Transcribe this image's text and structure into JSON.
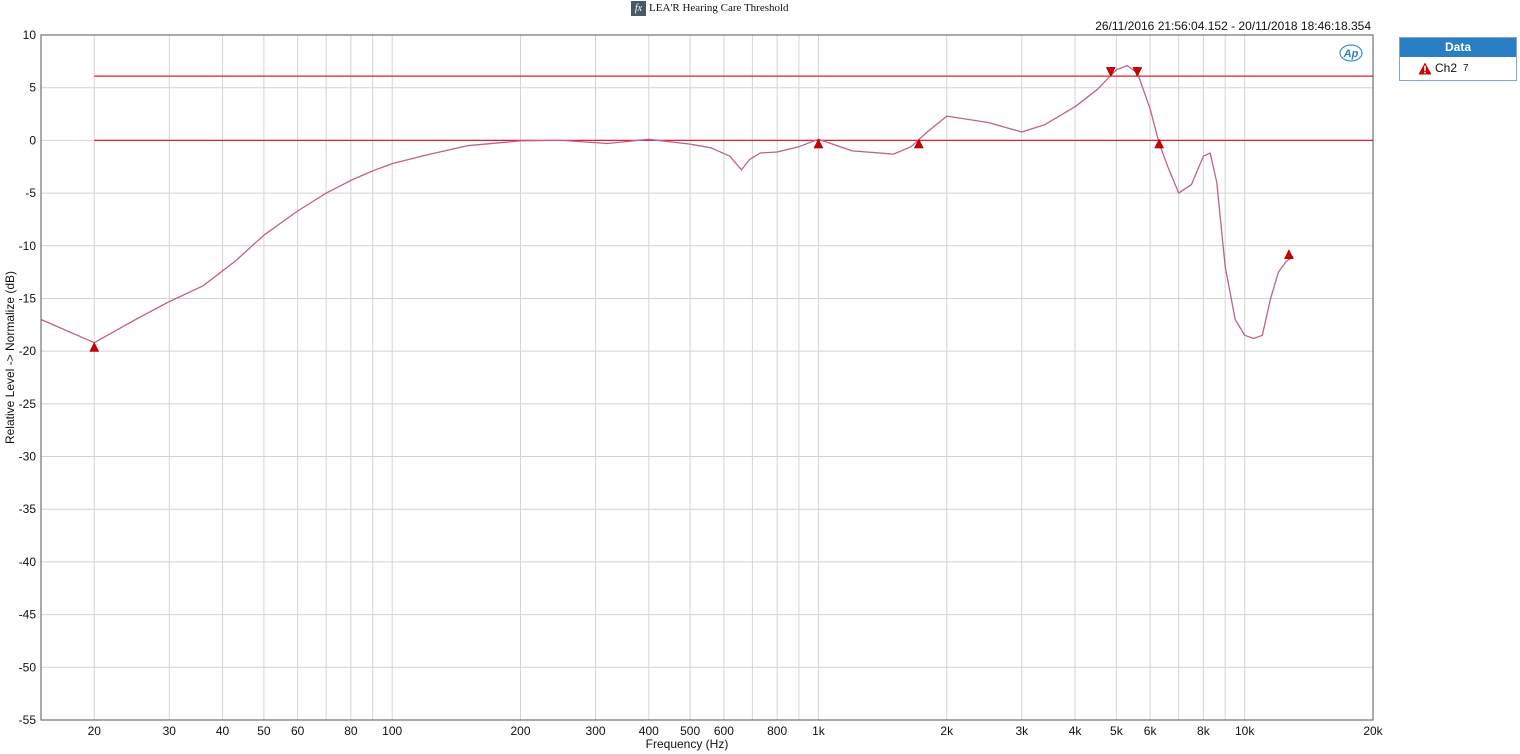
{
  "header": {
    "title": "LEA'R Hearing Care Threshold",
    "icon": "fx-icon",
    "timestamp": "26/11/2016 21:56:04.152 - 20/11/2018 18:46:18.354",
    "logo": "Ap"
  },
  "legend": {
    "header": "Data",
    "items": [
      {
        "label": "Ch2",
        "sub": "7",
        "color": "#cc0000"
      }
    ]
  },
  "chart_data": {
    "type": "line",
    "xlabel": "Frequency (Hz)",
    "ylabel": "Relative Level -> Normalize (dB)",
    "xscale": "log",
    "xlim": [
      15,
      20000
    ],
    "ylim": [
      -55,
      10
    ],
    "grid": true,
    "legend_position": "right",
    "x_ticks": [
      {
        "v": 20,
        "label": "20"
      },
      {
        "v": 30,
        "label": "30"
      },
      {
        "v": 40,
        "label": "40"
      },
      {
        "v": 50,
        "label": "50"
      },
      {
        "v": 60,
        "label": "60"
      },
      {
        "v": 80,
        "label": "80"
      },
      {
        "v": 100,
        "label": "100"
      },
      {
        "v": 200,
        "label": "200"
      },
      {
        "v": 300,
        "label": "300"
      },
      {
        "v": 400,
        "label": "400"
      },
      {
        "v": 500,
        "label": "500"
      },
      {
        "v": 600,
        "label": "600"
      },
      {
        "v": 800,
        "label": "800"
      },
      {
        "v": 1000,
        "label": "1k"
      },
      {
        "v": 2000,
        "label": "2k"
      },
      {
        "v": 3000,
        "label": "3k"
      },
      {
        "v": 4000,
        "label": "4k"
      },
      {
        "v": 5000,
        "label": "5k"
      },
      {
        "v": 6000,
        "label": "6k"
      },
      {
        "v": 8000,
        "label": "8k"
      },
      {
        "v": 10000,
        "label": "10k"
      },
      {
        "v": 20000,
        "label": "20k"
      }
    ],
    "y_ticks": [
      10,
      5,
      0,
      -5,
      -10,
      -15,
      -20,
      -25,
      -30,
      -35,
      -40,
      -45,
      -50,
      -55
    ],
    "reference_lines": [
      {
        "y": 6.1,
        "color": "#dd2222"
      },
      {
        "y": 0,
        "color": "#dd2222"
      }
    ],
    "series": [
      {
        "name": "Ch2",
        "color": "#c06090",
        "x": [
          15,
          20,
          25,
          30,
          36,
          43,
          50,
          60,
          70,
          80,
          90,
          100,
          120,
          150,
          200,
          250,
          320,
          400,
          500,
          560,
          620,
          660,
          690,
          730,
          800,
          900,
          1000,
          1200,
          1500,
          1650,
          1800,
          2000,
          2500,
          3000,
          3400,
          4000,
          4500,
          5000,
          5300,
          5600,
          6000,
          6300,
          6600,
          7000,
          7500,
          8000,
          8300,
          8600,
          9000,
          9500,
          10000,
          10500,
          11000,
          11500,
          12000,
          12500,
          13000
        ],
        "values": [
          -17,
          -19.2,
          -17,
          -15.3,
          -13.8,
          -11.4,
          -9,
          -6.7,
          -5,
          -3.8,
          -2.9,
          -2.2,
          -1.4,
          -0.5,
          -0.05,
          0,
          -0.3,
          0.1,
          -0.35,
          -0.7,
          -1.5,
          -2.8,
          -1.8,
          -1.2,
          -1.1,
          -0.6,
          0.1,
          -1,
          -1.3,
          -0.6,
          0.8,
          2.3,
          1.7,
          0.8,
          1.5,
          3.2,
          4.8,
          6.7,
          7.1,
          6.4,
          3,
          -0.3,
          -2.5,
          -5,
          -4.2,
          -1.5,
          -1.2,
          -4,
          -12,
          -17,
          -18.5,
          -18.8,
          -18.5,
          -15,
          -12.5,
          -11.5,
          -11
        ]
      }
    ],
    "markers": [
      {
        "x": 20,
        "y": -19.6,
        "dir": "up"
      },
      {
        "x": 1000,
        "y": -0.3,
        "dir": "up"
      },
      {
        "x": 1720,
        "y": -0.3,
        "dir": "up"
      },
      {
        "x": 4850,
        "y": 6.5,
        "dir": "down"
      },
      {
        "x": 5600,
        "y": 6.5,
        "dir": "down"
      },
      {
        "x": 6300,
        "y": -0.3,
        "dir": "up"
      },
      {
        "x": 12700,
        "y": -10.8,
        "dir": "up"
      }
    ]
  }
}
